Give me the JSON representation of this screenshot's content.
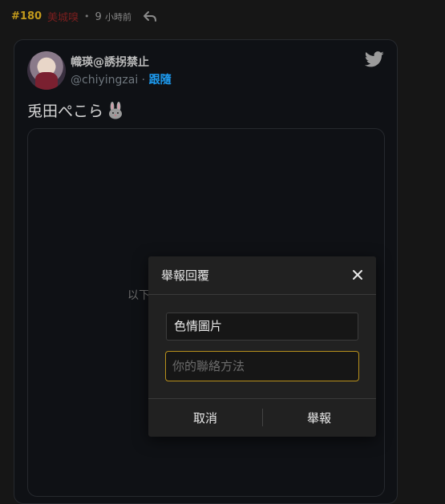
{
  "post": {
    "number": "#180",
    "user": "美城嗅",
    "dot": "•",
    "time_num": "9",
    "time_unit": "小時前"
  },
  "tweet": {
    "author_name": "幟瑛@誘拐禁止",
    "handle": "@chiyingzai",
    "separator": " · ",
    "follow": "跟隨",
    "text": "兎田ぺこら",
    "media_warning": "以下"
  },
  "modal": {
    "title": "舉報回覆",
    "reason": "色情圖片",
    "contact_placeholder": "你的聯絡方法",
    "cancel": "取消",
    "report": "舉報"
  },
  "colors": {
    "background": "#161616",
    "post_number": "#c39a1c",
    "follow_link": "#1d9bf0",
    "input_focus_border": "#b8901c",
    "modal_bg": "#212121"
  },
  "icons": [
    "reply-icon",
    "twitter-bird-icon",
    "rabbit-emoji-icon",
    "close-icon"
  ]
}
